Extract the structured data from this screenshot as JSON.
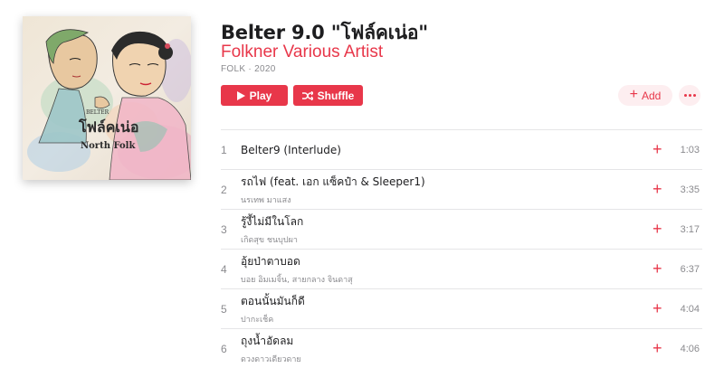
{
  "album": {
    "title": "Belter 9.0 \"โฟล์คเน่อ\"",
    "artist": "Folkner Various Artist",
    "meta": "FOLK · 2020",
    "artwork_text": {
      "brand": "BELTER",
      "title": "โฟล์คเน่อ",
      "subtitle": "North Folk"
    }
  },
  "actions": {
    "play_label": "Play",
    "shuffle_label": "Shuffle",
    "add_label": "Add",
    "add_icon": "plus-icon",
    "more_icon": "ellipsis-icon"
  },
  "colors": {
    "accent": "#e8374a",
    "accent_soft": "#fdeef0",
    "secondary_text": "#8a8a8e"
  },
  "tracks": [
    {
      "number": "1",
      "title": "Belter9 (Interlude)",
      "artist": "",
      "duration": "1:03"
    },
    {
      "number": "2",
      "title": "รถไฟ (feat. เอก แซ็คป๋า & Sleeper1)",
      "artist": "นรเทพ มาแสง",
      "duration": "3:35"
    },
    {
      "number": "3",
      "title": "รู้งี้ไม่มีในโลก",
      "artist": "เกิดสุข ชนบุปผา",
      "duration": "3:17"
    },
    {
      "number": "4",
      "title": "อุ้ยป่าตาบอด",
      "artist": "บอย อิมเมจิ้น, สายกลาง จินดาสุ",
      "duration": "6:37"
    },
    {
      "number": "5",
      "title": "ตอนนั้นมันก็ดี",
      "artist": "ปากะเช็ค",
      "duration": "4:04"
    },
    {
      "number": "6",
      "title": "ถุงน้ำอัดลม",
      "artist": "ดวงดาวเดียวดาย",
      "duration": "4:06"
    }
  ]
}
